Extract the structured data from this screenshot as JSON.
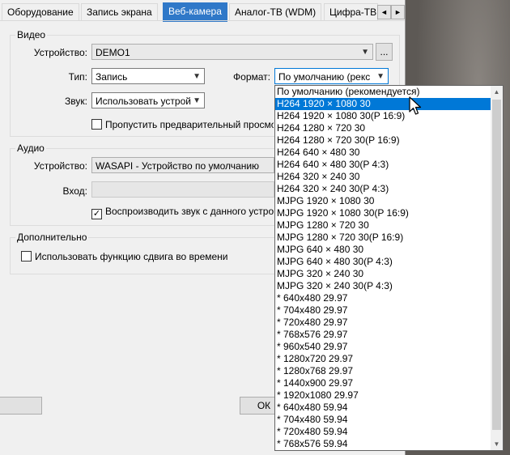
{
  "tabs": [
    "Оборудование",
    "Запись экрана",
    "Веб-камера",
    "Аналог-ТВ (WDM)",
    "Цифра-ТВ"
  ],
  "tab_scroll": {
    "left": "◄",
    "right": "►"
  },
  "video": {
    "title": "Видео",
    "device_label": "Устройство:",
    "device_value": "DEMO1",
    "browse_label": "...",
    "type_label": "Тип:",
    "type_value": "Запись",
    "format_label": "Формат:",
    "format_value": "По умолчанию (рекс",
    "sound_label": "Звук:",
    "sound_value": "Использовать устрой",
    "skip_preview_label": "Пропустить предварительный просмо"
  },
  "audio": {
    "title": "Аудио",
    "device_label": "Устройство:",
    "device_value": "WASAPI - Устройство по умолчанию",
    "input_label": "Вход:",
    "play_sound_label": "Воспроизводить звук с данного устрой",
    "play_sound_checked": "✓"
  },
  "advanced": {
    "title": "Дополнительно",
    "timeshift_label": "Использовать функцию сдвига во времени"
  },
  "footer": {
    "ok_label": "ОК"
  },
  "format_options": [
    "По умолчанию (рекомендуется)",
    "H264 1920 × 1080 30",
    "H264 1920 × 1080 30(P 16:9)",
    "H264 1280 × 720 30",
    "H264 1280 × 720 30(P 16:9)",
    "H264 640 × 480 30",
    "H264 640 × 480 30(P 4:3)",
    "H264 320 × 240 30",
    "H264 320 × 240 30(P 4:3)",
    "MJPG 1920 × 1080 30",
    "MJPG 1920 × 1080 30(P 16:9)",
    "MJPG 1280 × 720 30",
    "MJPG 1280 × 720 30(P 16:9)",
    "MJPG 640 × 480 30",
    "MJPG 640 × 480 30(P 4:3)",
    "MJPG 320 × 240 30",
    "MJPG 320 × 240 30(P 4:3)",
    "* 640x480 29.97",
    "* 704x480 29.97",
    "* 720x480 29.97",
    "* 768x576 29.97",
    "* 960x540 29.97",
    "* 1280x720 29.97",
    "* 1280x768 29.97",
    "* 1440x900 29.97",
    "* 1920x1080 29.97",
    "* 640x480 59.94",
    "* 704x480 59.94",
    "* 720x480 59.94",
    "* 768x576 59.94"
  ],
  "selected_format_index": 1,
  "colors": {
    "accent": "#0078d7",
    "active_tab": "#2f78c8"
  }
}
